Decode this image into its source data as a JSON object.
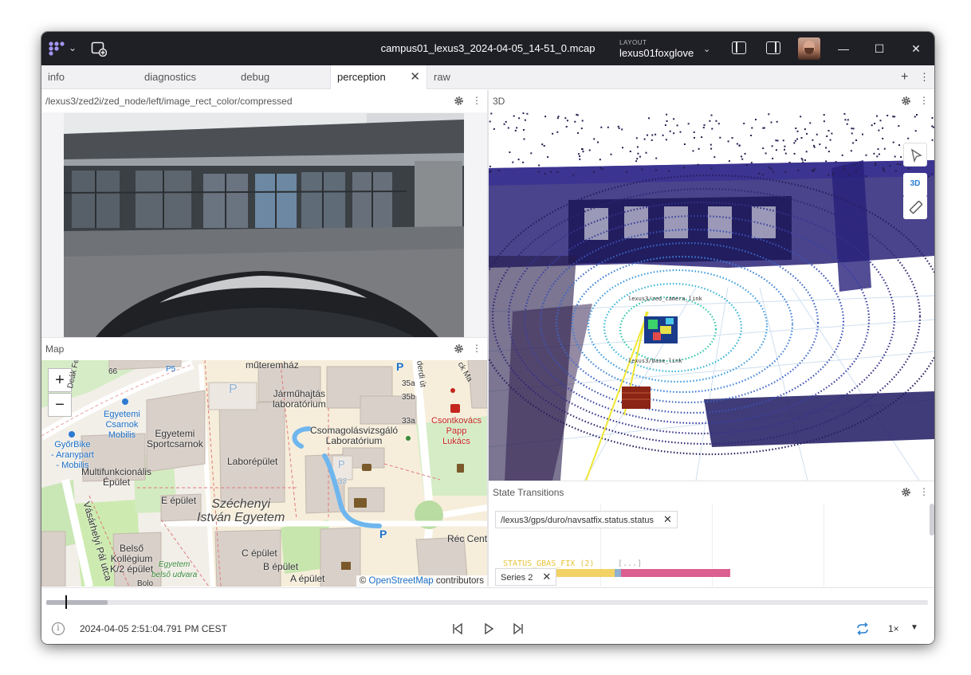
{
  "titlebar": {
    "file_name": "campus01_lexus3_2024-04-05_14-51_0.mcap",
    "layout_label": "LAYOUT",
    "layout_name": "lexus01foxglove",
    "chevron": "⌄",
    "minimize": "—",
    "maximize": "☐",
    "close": "✕"
  },
  "tabs": [
    {
      "label": "info"
    },
    {
      "label": "diagnostics"
    },
    {
      "label": "debug"
    },
    {
      "label": "perception"
    },
    {
      "label": "raw"
    }
  ],
  "tab_controls": {
    "close": "✕",
    "add": "+",
    "more": "⋮"
  },
  "panels": {
    "image": {
      "title": "/lexus3/zed2i/zed_node/left/image_rect_color/compressed"
    },
    "map": {
      "title": "Map"
    },
    "scene3d": {
      "title": "3D",
      "mode_button": "3D"
    },
    "state": {
      "title": "State Transitions"
    }
  },
  "panel_more": "⋮",
  "map": {
    "zoom_in": "+",
    "zoom_out": "−",
    "attribution_prefix": "©",
    "attribution_link": "OpenStreetMap",
    "attribution_suffix": "contributors",
    "labels": {
      "muteremhaz": "műteremház",
      "deak": "Deák Ferenc sétá",
      "num66": "66",
      "p5": "P5",
      "egyetemi_csarnok": "Egyetemi\nCsarnok\nMobilis",
      "gyorbike": "GyőrBike\n- Aranypart\n- Mobilis",
      "egyetemi_sport": "Egyetemi\nSportcsarnok",
      "multifunk": "Multifunkcionális\nÉpület",
      "e_epulet": "E épület",
      "vasarhelyi": "Vásárhelyi Pál utca",
      "jarmuhajtas": "Járműhajtás\nlaboratórium",
      "csomagolas": "Csomagolásvizsgáló\nLaboratórium",
      "laborepulet": "Laborépület",
      "szechenyi": "Széchenyi\nIstván Egyetem",
      "num35a": "35a",
      "num35b": "35b",
      "num33a": "33a",
      "derdi": "derdi út",
      "ck_ma": "ck Ma",
      "csontkovacs": "Csontkovács\nPapp\nLukács",
      "rec_cente": "Réc Cente",
      "c_epulet": "C épület",
      "b_epulet": "B épület",
      "a_epulet": "A épület",
      "belso_kollegium": "Belső\nKollégium\nK/2 épület",
      "egyetem_belso": "Egyetem\nbelső udvara",
      "p_lot": "P",
      "p_small": "P",
      "p33": "33",
      "bolo": "Bolo"
    }
  },
  "scene3d": {
    "frame_camera": "lexus3/zed_camera_link",
    "frame_base": "lexus3/base_link"
  },
  "state": {
    "topic1": "/lexus3/gps/duro/navsatfix.status.status",
    "topic2": "Series 2",
    "chip_close": "✕",
    "state_label": "STATUS_GBAS_FIX (2)",
    "state_ellipsis": "[...]"
  },
  "playback": {
    "info_glyph": "i",
    "timestamp": "2024-04-05 2:51:04.791 PM CEST",
    "speed": "1×",
    "speed_chevron": "▼",
    "progress_loaded": 0.07,
    "playhead": 0.022
  },
  "colors": {
    "titlebar_bg": "#1f1f26",
    "accent": "#2b7fd0",
    "state_yellow": "#f2d264",
    "state_pink": "#dc5f91",
    "route_blue": "#6fb6ee"
  }
}
